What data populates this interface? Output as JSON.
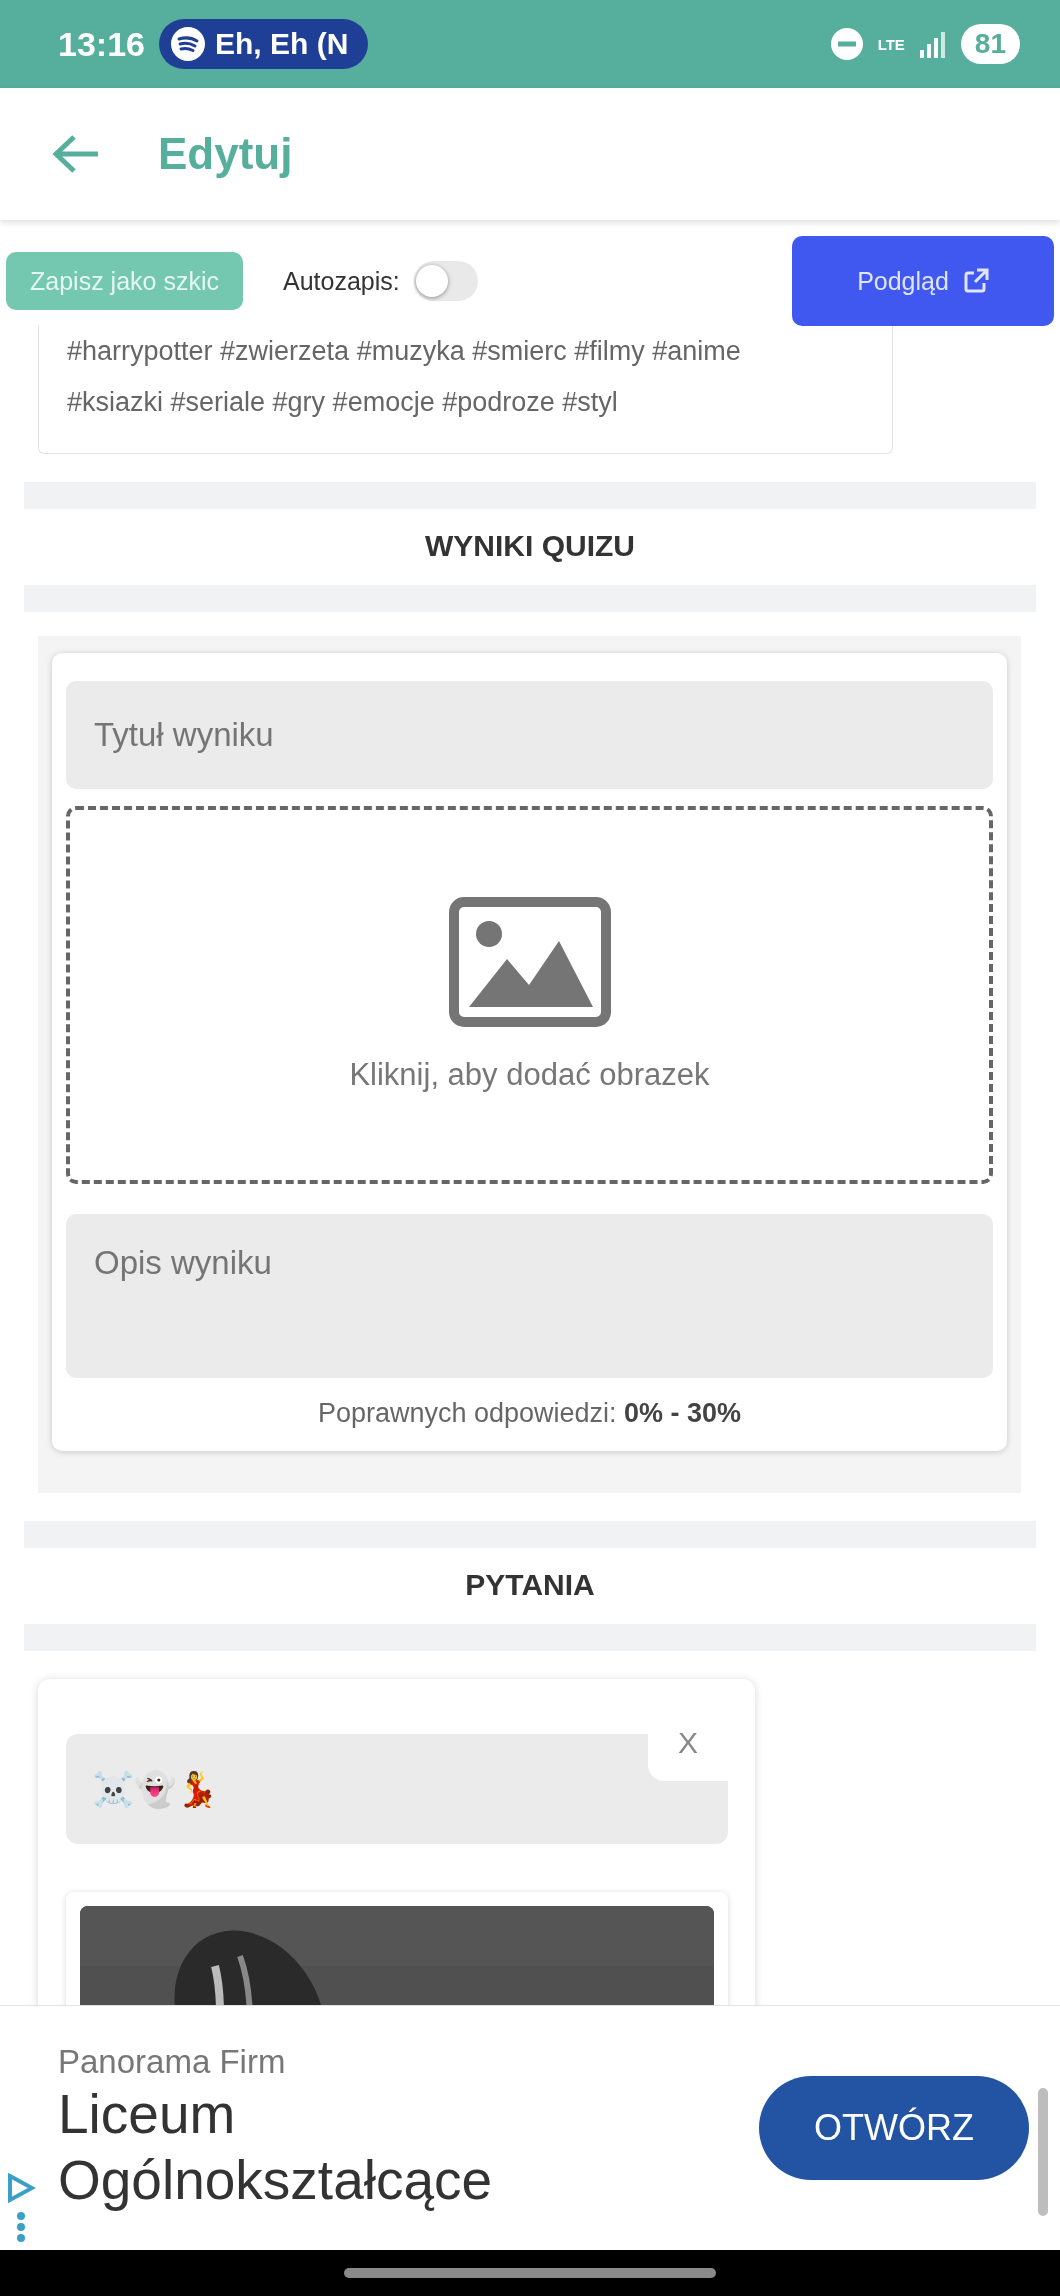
{
  "status_bar": {
    "time": "13:16",
    "media": "Eh, Eh (N",
    "network": "LTE",
    "battery": "81"
  },
  "app_bar": {
    "title": "Edytuj"
  },
  "toolbar": {
    "draft_button": "Zapisz jako szkic",
    "autosave": {
      "label": "Autozapis:",
      "on": false
    },
    "preview_button": "Podgląd"
  },
  "tags": {
    "lines": [
      "#harrypotter #zwierzeta #muzyka #smierc #filmy #anime",
      "#ksiazki #seriale #gry #emocje #podroze #styl"
    ]
  },
  "results": {
    "heading": "WYNIKI QUIZU",
    "title_placeholder": "Tytuł wyniku",
    "image_hint": "Kliknij, aby dodać obrazek",
    "description_placeholder": "Opis wyniku",
    "range": "Poprawnych odpowiedzi: **0% - 30%**"
  },
  "questions": {
    "heading": "PYTANIA",
    "close": "X",
    "question_value": "☠️👻💃"
  },
  "ad": {
    "advertiser": "Panorama Firm",
    "headline": "Liceum Ogólnokształcące",
    "button": "OTWÓRZ"
  }
}
